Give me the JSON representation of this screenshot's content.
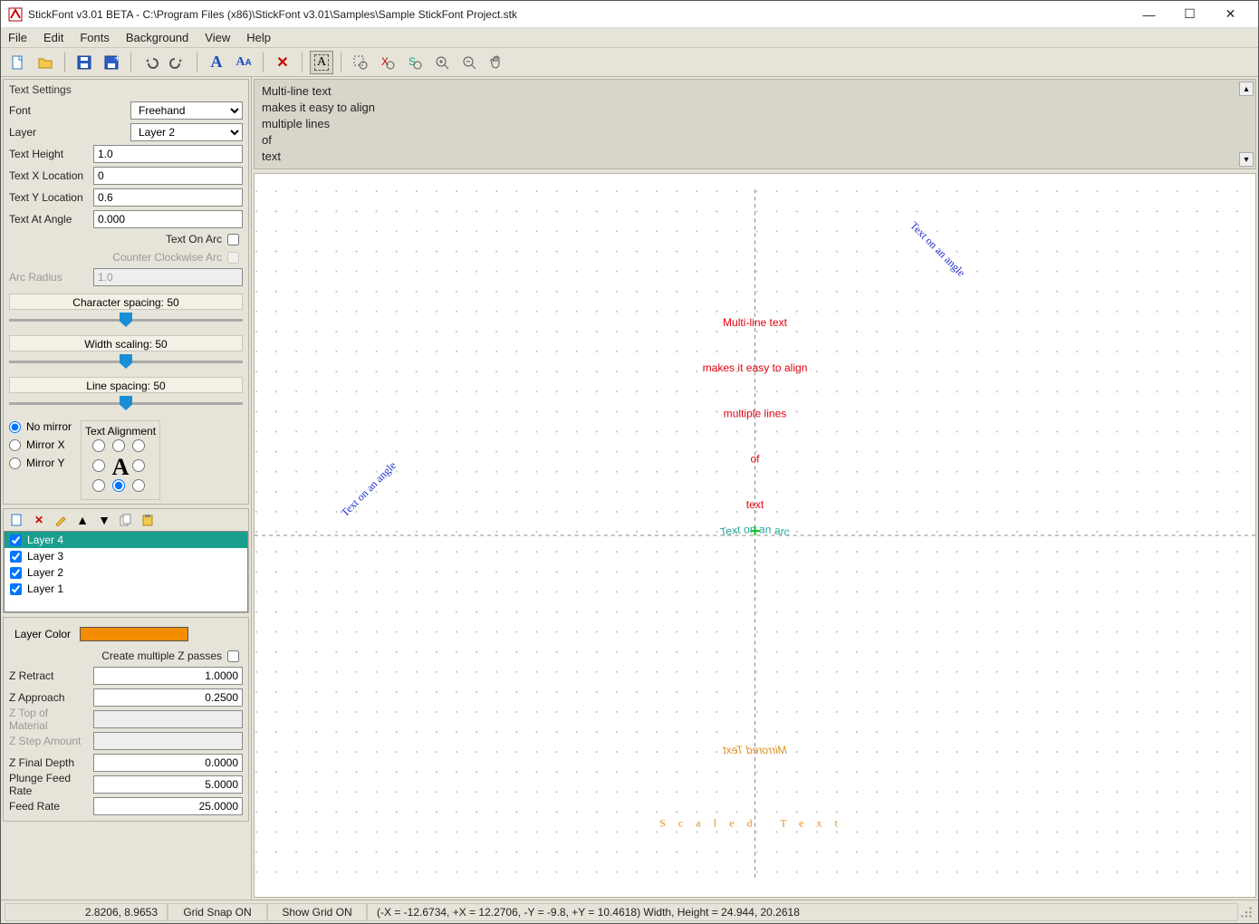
{
  "window": {
    "title": "StickFont v3.01 BETA - C:\\Program Files (x86)\\StickFont v3.01\\Samples\\Sample StickFont Project.stk"
  },
  "menu": [
    "File",
    "Edit",
    "Fonts",
    "Background",
    "View",
    "Help"
  ],
  "textSettings": {
    "title": "Text Settings",
    "fontLabel": "Font",
    "fontValue": "Freehand",
    "layerLabel": "Layer",
    "layerValue": "Layer 2",
    "textHeightLabel": "Text Height",
    "textHeightValue": "1.0",
    "textXLabel": "Text X Location",
    "textXValue": "0",
    "textYLabel": "Text Y Location",
    "textYValue": "0.6",
    "textAngleLabel": "Text At Angle",
    "textAngleValue": "0.000",
    "textOnArcLabel": "Text On Arc",
    "ccwArcLabel": "Counter Clockwise Arc",
    "arcRadiusLabel": "Arc Radius",
    "arcRadiusValue": "1.0",
    "charSpacing": "Character spacing:  50",
    "widthScaling": "Width scaling:  50",
    "lineSpacing": "Line spacing:  50",
    "mirror": {
      "none": "No mirror",
      "x": "Mirror X",
      "y": "Mirror Y"
    },
    "alignLabel": "Text Alignment"
  },
  "layers": [
    "Layer 4",
    "Layer 3",
    "Layer 2",
    "Layer 1"
  ],
  "zprops": {
    "layerColorLabel": "Layer Color",
    "multiZLabel": "Create multiple Z passes",
    "zRetractLabel": "Z Retract",
    "zRetractValue": "1.0000",
    "zApproachLabel": "Z Approach",
    "zApproachValue": "0.2500",
    "zTopLabel": "Z Top of Material",
    "zStepLabel": "Z Step Amount",
    "zFinalLabel": "Z Final Depth",
    "zFinalValue": "0.0000",
    "plungeLabel": "Plunge Feed Rate",
    "plungeValue": "5.0000",
    "feedLabel": "Feed Rate",
    "feedValue": "25.0000"
  },
  "preview": {
    "l1": "Multi-line text",
    "l2": "makes it easy to align",
    "l3": "multiple lines",
    "l4": "of",
    "l5": "text"
  },
  "canvas": {
    "red1": "Multi-line text",
    "red2": "makes it easy to align",
    "red3": "multiple lines",
    "red4": "of",
    "red5": "text",
    "blueLeft": "Text on an angle",
    "blueRight": "Text on an angle",
    "tealArc": "Text on an arc",
    "mirrored": "Mirrored Text",
    "scaled": "Scaled Text"
  },
  "status": {
    "coords": "2.8206,    8.9653",
    "gridSnap": "Grid Snap ON",
    "showGrid": "Show Grid ON",
    "extents": "(-X = -12.6734, +X = 12.2706, -Y = -9.8, +Y = 10.4618) Width, Height = 24.944, 20.2618"
  }
}
